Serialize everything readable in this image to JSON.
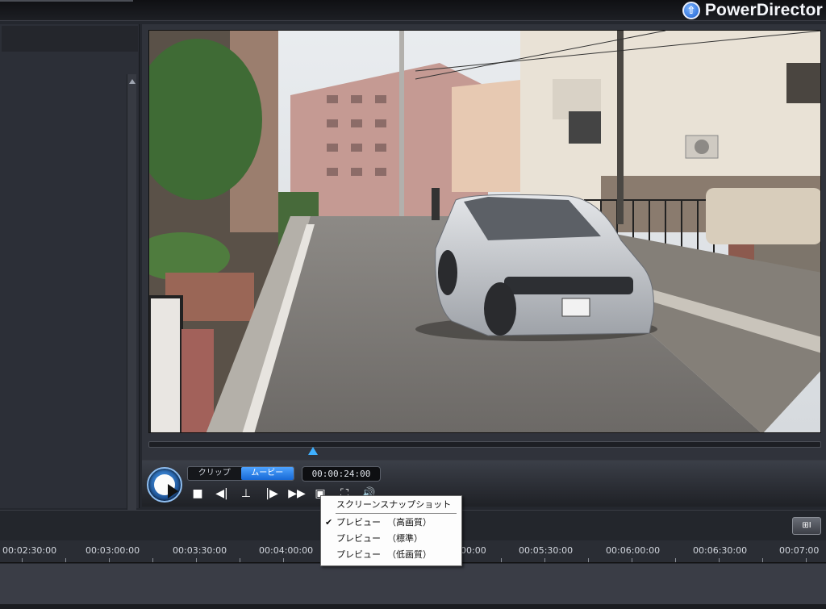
{
  "app": {
    "brand": "PowerDirector"
  },
  "preview": {
    "mode_tabs": [
      {
        "label": "クリップ",
        "active": false
      },
      {
        "label": "ムービー",
        "active": true
      }
    ],
    "timecode": "00:00:24:00",
    "scrub_position": 0.244
  },
  "controls": {
    "stop": "■",
    "prev_frame": "◀|",
    "mark": "⊥",
    "next_frame": "|▶",
    "fast_forward": "▶▶",
    "snapshot": "▣",
    "fullscreen": "⛶",
    "volume": "🔊"
  },
  "context_menu": {
    "items": [
      {
        "label": "スクリーンスナップショット",
        "sub": "",
        "checked": ""
      },
      {
        "label": "プレビュー",
        "sub": "（高画質）",
        "checked": "✔"
      },
      {
        "label": "プレビュー",
        "sub": "（標準）",
        "checked": ""
      },
      {
        "label": "プレビュー",
        "sub": "（低画質）",
        "checked": ""
      }
    ]
  },
  "timeline": {
    "ruler": [
      "00:02:30:00",
      "00:03:00:00",
      "00:03:30:00",
      "00:04:00:00",
      "00:00",
      "00:05:30:00",
      "00:06:00:00",
      "00:06:30:00",
      "00:07:00"
    ],
    "toolbar_button": "⊞I"
  },
  "colors": {
    "accent": "#3fb0ff",
    "panel": "#2c2f37",
    "bg": "#24272e"
  }
}
